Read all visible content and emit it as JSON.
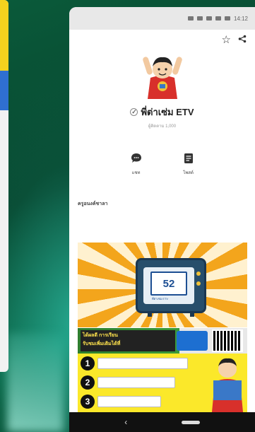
{
  "statusbar": {
    "time": "14:12"
  },
  "profile": {
    "name": "พี่ต่าเซ่ม ETV",
    "subtitle": "ผู้ติดตาม 1,000"
  },
  "actions": [
    {
      "label": "แชท",
      "icon": "chat-bubble-icon"
    },
    {
      "label": "โพสต์",
      "icon": "document-icon"
    }
  ],
  "section": {
    "title": "ครูอนงค์ชาลา"
  },
  "banner": {
    "tv_number": "52",
    "tv_caption": "พี่ต่าเซ่ม ETV",
    "strip_text_1": "ได้ผลดี การเรียน",
    "strip_text_2": "รับชมเพิ่มเติมได้ที่",
    "steps": [
      "1",
      "2",
      "3"
    ]
  },
  "colors": {
    "background": "#063c2a",
    "banner_orange": "#f3a51c",
    "banner_yellow": "#fbe82a",
    "tv_blue": "#274e6b"
  }
}
